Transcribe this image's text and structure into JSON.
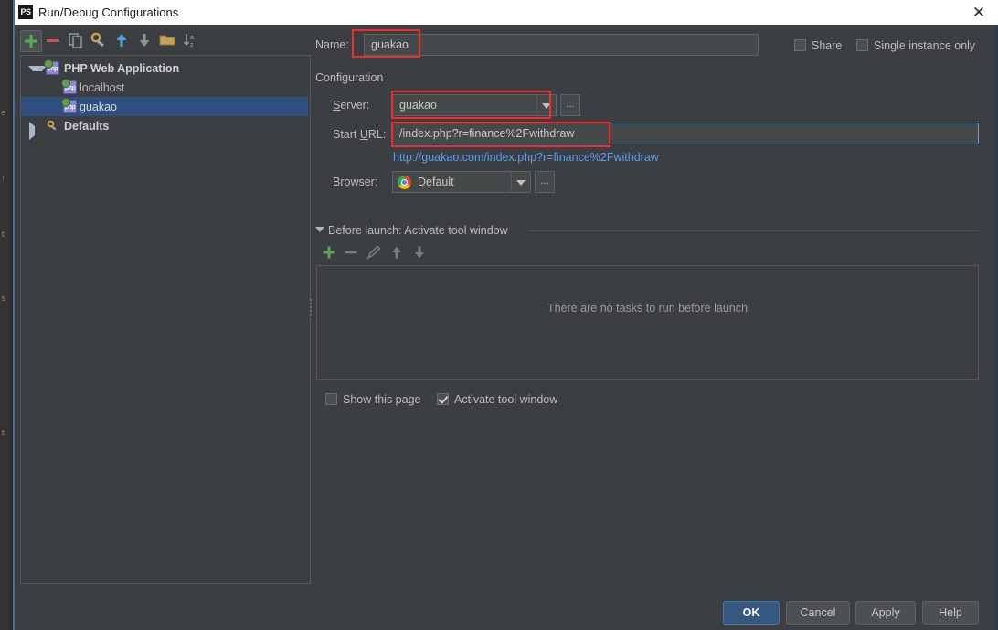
{
  "window": {
    "title": "Run/Debug Configurations",
    "app_icon": "PS",
    "close_icon": "✕"
  },
  "left_toolbar": {
    "buttons": [
      {
        "name": "add-configuration-button",
        "icon": "plus-icon",
        "selected": true
      },
      {
        "name": "remove-configuration-button",
        "icon": "minus-icon",
        "selected": false
      },
      {
        "name": "copy-configuration-button",
        "icon": "copy-icon",
        "selected": false
      },
      {
        "name": "edit-templates-button",
        "icon": "wrench-icon",
        "selected": false
      },
      {
        "name": "move-up-button",
        "icon": "arrow-up-icon",
        "selected": false
      },
      {
        "name": "move-down-button",
        "icon": "arrow-down-icon",
        "selected": false
      },
      {
        "name": "move-into-folder-button",
        "icon": "folder-icon",
        "selected": false
      },
      {
        "name": "sort-configurations-button",
        "icon": "sort-az-icon",
        "selected": false
      }
    ]
  },
  "tree": {
    "items": [
      {
        "label": "PHP Web Application",
        "level": 0,
        "icon": "php-web-icon",
        "twisty": "down",
        "bold": true,
        "selected": false
      },
      {
        "label": "localhost",
        "level": 1,
        "icon": "php-icon",
        "twisty": "none",
        "bold": false,
        "selected": false
      },
      {
        "label": "guakao",
        "level": 1,
        "icon": "php-icon",
        "twisty": "none",
        "bold": false,
        "selected": true
      },
      {
        "label": "Defaults",
        "level": 0,
        "icon": "wrench-icon",
        "twisty": "right",
        "bold": true,
        "selected": false
      }
    ]
  },
  "form": {
    "name_label": "Name:",
    "name_value": "guakao",
    "share_label": "Share",
    "share_checked": false,
    "single_instance_label": "Single instance only",
    "single_instance_checked": false,
    "configuration_section_label": "Configuration",
    "server_label": "Server:",
    "server_value": "guakao",
    "server_browse_label": "...",
    "start_url_label": "Start URL:",
    "start_url_value": "/index.php?r=finance%2Fwithdraw",
    "resolved_url": "http://guakao.com/index.php?r=finance%2Fwithdraw",
    "browser_label": "Browser:",
    "browser_value": "Default",
    "browser_icon": "chrome-icon",
    "browser_browse_label": "..."
  },
  "before_launch": {
    "title": "Before launch: Activate tool window",
    "toolbar": [
      {
        "name": "add-task-button",
        "icon": "plus-icon"
      },
      {
        "name": "remove-task-button",
        "icon": "minus-icon"
      },
      {
        "name": "edit-task-button",
        "icon": "pencil-icon"
      },
      {
        "name": "task-move-up-button",
        "icon": "arrow-up-icon"
      },
      {
        "name": "task-move-down-button",
        "icon": "arrow-down-icon"
      }
    ],
    "empty_message": "There are no tasks to run before launch",
    "show_this_page_label": "Show this page",
    "show_this_page_checked": false,
    "activate_tool_window_label": "Activate tool window",
    "activate_tool_window_checked": true
  },
  "footer": {
    "ok": "OK",
    "cancel": "Cancel",
    "apply": "Apply",
    "help": "Help"
  },
  "background_editor": {
    "glyphs": [
      "e",
      "!",
      "t",
      "s",
      "t"
    ]
  },
  "colors": {
    "accent_blue": "#365880",
    "annotation_red": "#f22c2c",
    "link_blue": "#589df6",
    "selection_blue": "#2f4f7f",
    "dialog_bg": "#3c3f41",
    "field_bg": "#45494a"
  }
}
